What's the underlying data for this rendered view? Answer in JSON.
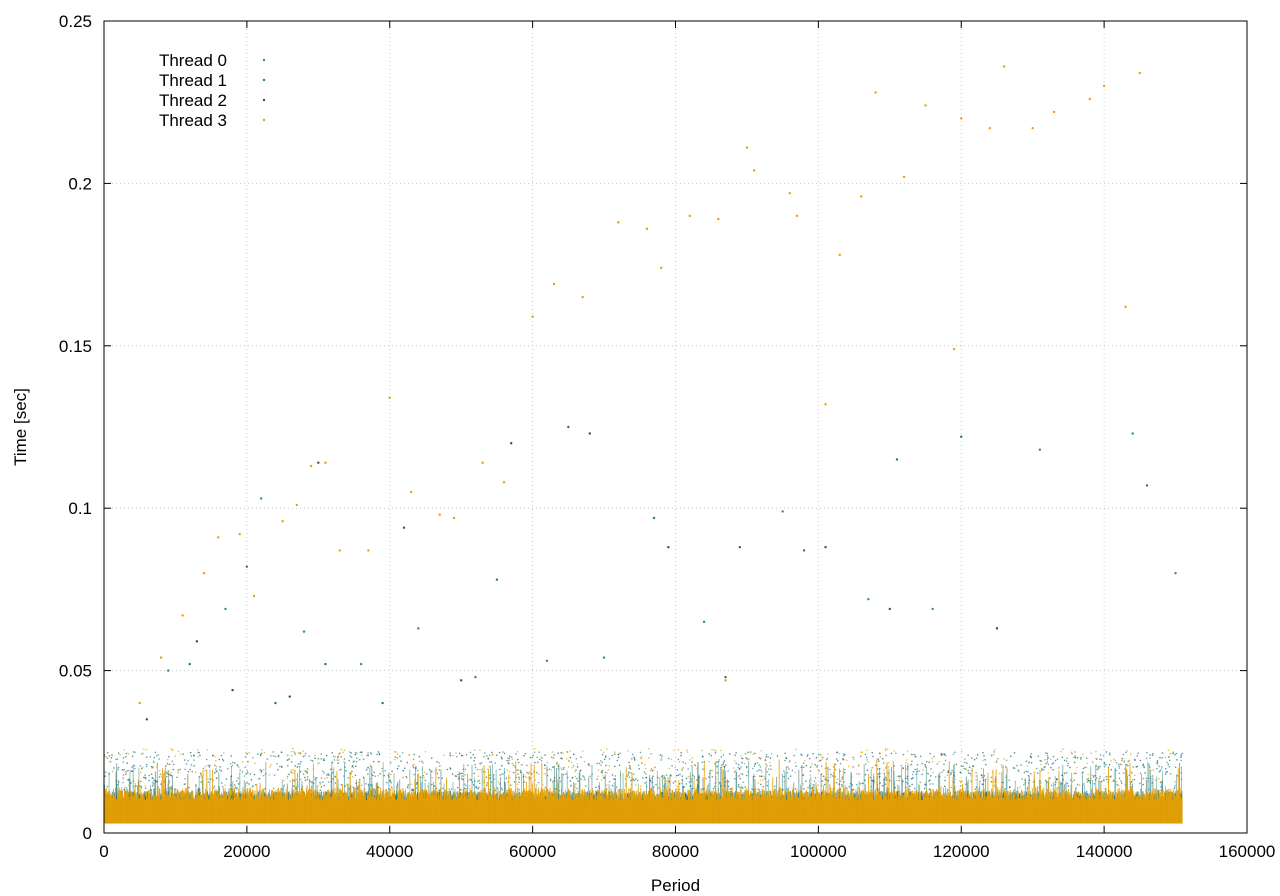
{
  "chart_data": {
    "type": "scatter",
    "title": "",
    "xlabel": "Period",
    "ylabel": "Time [sec]",
    "xlim": [
      0,
      160000
    ],
    "ylim": [
      0,
      0.25
    ],
    "x_ticks": [
      0,
      20000,
      40000,
      60000,
      80000,
      100000,
      120000,
      140000,
      160000
    ],
    "x_tick_labels": [
      "0",
      "20000",
      "40000",
      "60000",
      "80000",
      "100000",
      "120000",
      "140000",
      "160000"
    ],
    "y_ticks": [
      0,
      0.05,
      0.1,
      0.15,
      0.2,
      0.25
    ],
    "y_tick_labels": [
      "0",
      "0.05",
      "0.1",
      "0.15",
      "0.2",
      "0.25"
    ],
    "grid": true,
    "legend_position": "top-left",
    "x_data_extent": [
      0,
      151000
    ],
    "series": [
      {
        "name": "Thread 0",
        "color": "#2e8b8b",
        "typical_band": [
          0.003,
          0.009
        ],
        "points": [
          [
            9000,
            0.05
          ],
          [
            17000,
            0.069
          ],
          [
            22000,
            0.103
          ],
          [
            28000,
            0.062
          ],
          [
            36000,
            0.052
          ],
          [
            44000,
            0.063
          ],
          [
            52000,
            0.048
          ],
          [
            62000,
            0.053
          ],
          [
            70000,
            0.054
          ],
          [
            84000,
            0.065
          ],
          [
            95000,
            0.099
          ],
          [
            107000,
            0.072
          ],
          [
            116000,
            0.069
          ],
          [
            131000,
            0.118
          ],
          [
            144000,
            0.123
          ],
          [
            150000,
            0.08
          ]
        ]
      },
      {
        "name": "Thread 1",
        "color": "#1a7a7a",
        "typical_band": [
          0.003,
          0.009
        ],
        "points": [
          [
            12000,
            0.052
          ],
          [
            20000,
            0.082
          ],
          [
            24000,
            0.04
          ],
          [
            31000,
            0.052
          ],
          [
            39000,
            0.04
          ],
          [
            55000,
            0.078
          ],
          [
            65000,
            0.125
          ],
          [
            77000,
            0.097
          ],
          [
            87000,
            0.048
          ],
          [
            98000,
            0.087
          ],
          [
            111000,
            0.115
          ],
          [
            120000,
            0.122
          ],
          [
            146000,
            0.107
          ]
        ]
      },
      {
        "name": "Thread 2",
        "color": "#1e5a5a",
        "typical_band": [
          0.003,
          0.009
        ],
        "points": [
          [
            6000,
            0.035
          ],
          [
            13000,
            0.059
          ],
          [
            18000,
            0.044
          ],
          [
            26000,
            0.042
          ],
          [
            30000,
            0.114
          ],
          [
            42000,
            0.094
          ],
          [
            50000,
            0.047
          ],
          [
            57000,
            0.12
          ],
          [
            68000,
            0.123
          ],
          [
            79000,
            0.088
          ],
          [
            89000,
            0.088
          ],
          [
            101000,
            0.088
          ],
          [
            110000,
            0.069
          ],
          [
            125000,
            0.063
          ]
        ]
      },
      {
        "name": "Thread 3",
        "color": "#e8a000",
        "typical_band": [
          0.003,
          0.01
        ],
        "points": [
          [
            5000,
            0.04
          ],
          [
            8000,
            0.054
          ],
          [
            11000,
            0.067
          ],
          [
            14000,
            0.08
          ],
          [
            16000,
            0.091
          ],
          [
            19000,
            0.092
          ],
          [
            21000,
            0.073
          ],
          [
            25000,
            0.096
          ],
          [
            27000,
            0.101
          ],
          [
            29000,
            0.113
          ],
          [
            31000,
            0.114
          ],
          [
            33000,
            0.087
          ],
          [
            37000,
            0.087
          ],
          [
            40000,
            0.134
          ],
          [
            43000,
            0.105
          ],
          [
            47000,
            0.098
          ],
          [
            49000,
            0.097
          ],
          [
            53000,
            0.114
          ],
          [
            56000,
            0.108
          ],
          [
            60000,
            0.159
          ],
          [
            63000,
            0.169
          ],
          [
            67000,
            0.165
          ],
          [
            72000,
            0.188
          ],
          [
            76000,
            0.186
          ],
          [
            78000,
            0.174
          ],
          [
            82000,
            0.19
          ],
          [
            86000,
            0.189
          ],
          [
            90000,
            0.211
          ],
          [
            91000,
            0.204
          ],
          [
            96000,
            0.197
          ],
          [
            97000,
            0.19
          ],
          [
            101000,
            0.132
          ],
          [
            103000,
            0.178
          ],
          [
            106000,
            0.196
          ],
          [
            108000,
            0.228
          ],
          [
            112000,
            0.202
          ],
          [
            115000,
            0.224
          ],
          [
            119000,
            0.149
          ],
          [
            120000,
            0.22
          ],
          [
            124000,
            0.217
          ],
          [
            126000,
            0.236
          ],
          [
            130000,
            0.217
          ],
          [
            133000,
            0.222
          ],
          [
            138000,
            0.226
          ],
          [
            140000,
            0.23
          ],
          [
            143000,
            0.162
          ],
          [
            145000,
            0.234
          ],
          [
            87000,
            0.047
          ]
        ]
      }
    ]
  }
}
